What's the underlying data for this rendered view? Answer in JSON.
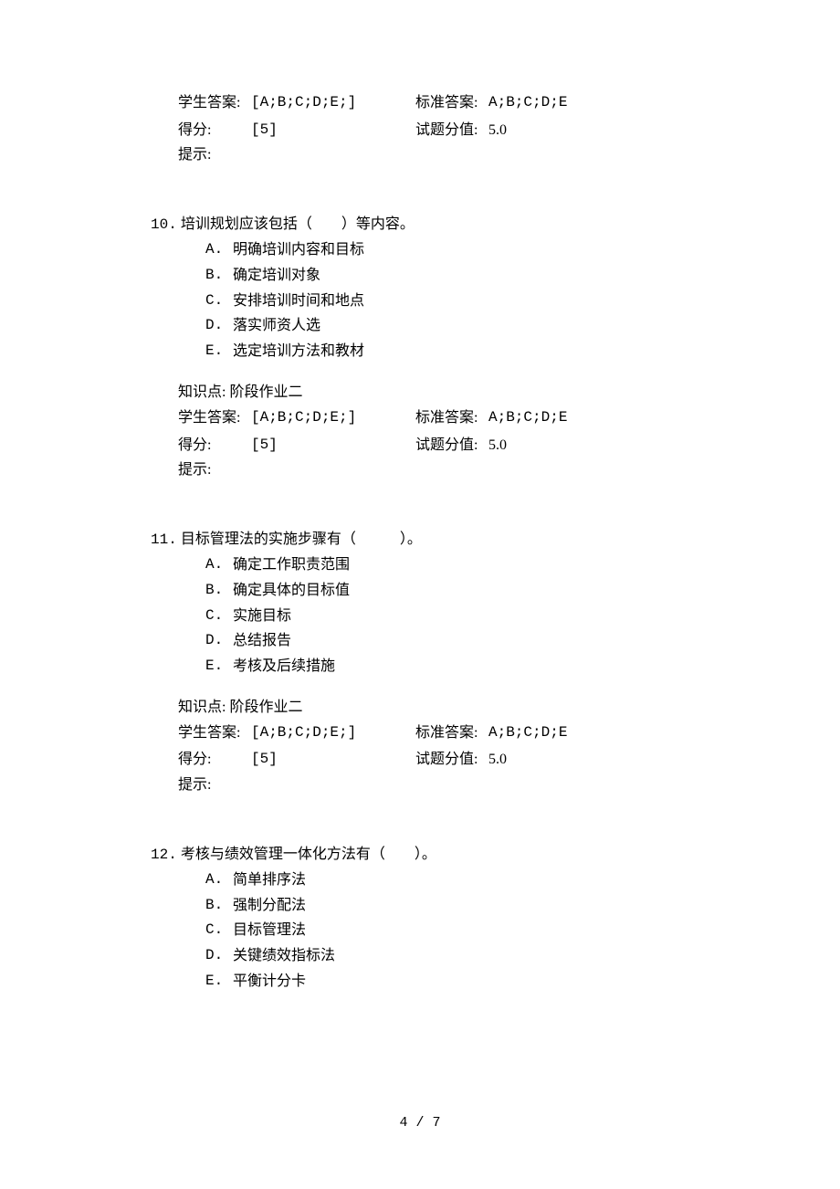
{
  "common": {
    "kp_label": "知识点:",
    "kp_value": "阶段作业二",
    "student_answer_label": "学生答案:",
    "standard_answer_label": "标准答案:",
    "score_label": "得分:",
    "score_total_label": "试题分值:",
    "tip_label": "提示:"
  },
  "q9": {
    "student_answer": "[A;B;C;D;E;]",
    "standard_answer": "A;B;C;D;E",
    "score": "[5]",
    "score_total": "5.0"
  },
  "q10": {
    "number": "10.",
    "stem": "培训规划应该包括（　　）等内容。",
    "options": [
      {
        "letter": "A.",
        "text": "明确培训内容和目标"
      },
      {
        "letter": "B.",
        "text": "确定培训对象"
      },
      {
        "letter": "C.",
        "text": "安排培训时间和地点"
      },
      {
        "letter": "D.",
        "text": "落实师资人选"
      },
      {
        "letter": "E.",
        "text": "选定培训方法和教材"
      }
    ],
    "student_answer": "[A;B;C;D;E;]",
    "standard_answer": "A;B;C;D;E",
    "score": "[5]",
    "score_total": "5.0"
  },
  "q11": {
    "number": "11.",
    "stem": "目标管理法的实施步骤有（　　　）。",
    "options": [
      {
        "letter": "A.",
        "text": "确定工作职责范围"
      },
      {
        "letter": "B.",
        "text": "确定具体的目标值"
      },
      {
        "letter": "C.",
        "text": "实施目标"
      },
      {
        "letter": "D.",
        "text": "总结报告"
      },
      {
        "letter": "E.",
        "text": "考核及后续措施"
      }
    ],
    "student_answer": "[A;B;C;D;E;]",
    "standard_answer": "A;B;C;D;E",
    "score": "[5]",
    "score_total": "5.0"
  },
  "q12": {
    "number": "12.",
    "stem": "考核与绩效管理一体化方法有（　　）。",
    "options": [
      {
        "letter": "A.",
        "text": "简单排序法"
      },
      {
        "letter": "B.",
        "text": "强制分配法"
      },
      {
        "letter": "C.",
        "text": "目标管理法"
      },
      {
        "letter": "D.",
        "text": "关键绩效指标法"
      },
      {
        "letter": "E.",
        "text": "平衡计分卡"
      }
    ]
  },
  "page_number": "4 / 7"
}
